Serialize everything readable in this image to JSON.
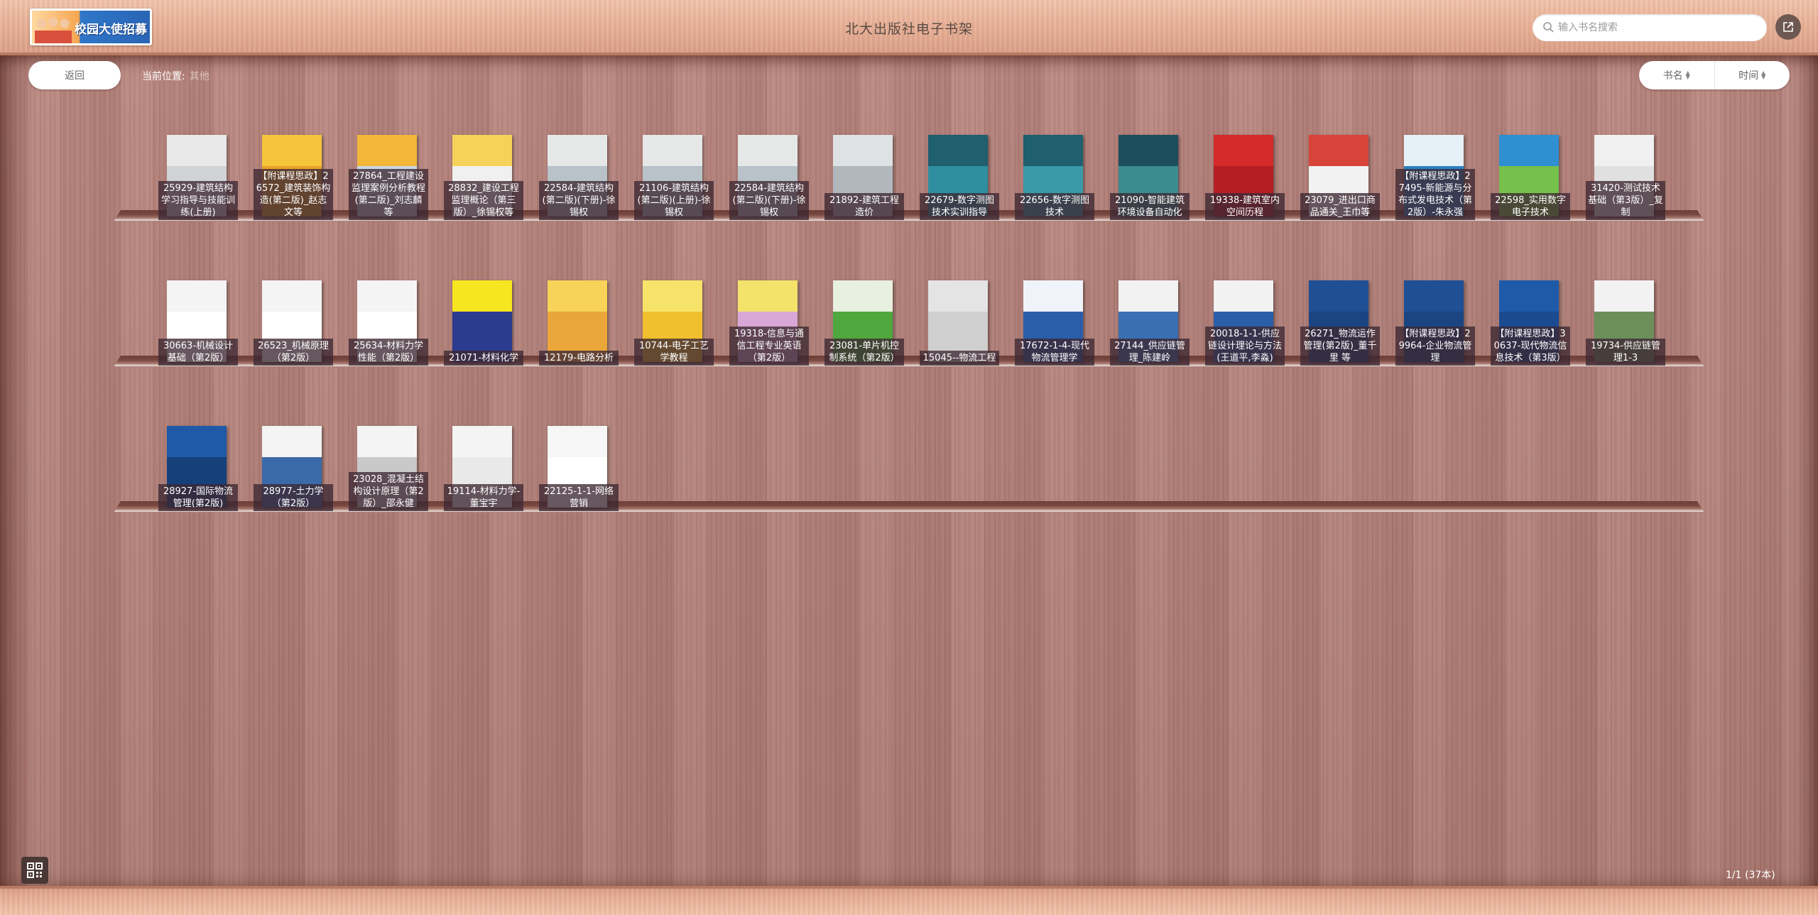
{
  "header": {
    "logo_text": "校园大使招募",
    "title": "北大出版社电子书架",
    "search_placeholder": "输入书名搜索"
  },
  "toolbar": {
    "back_label": "返回",
    "location_label": "当前位置:",
    "location_value": "其他",
    "sort_name": "书名",
    "sort_time": "时间"
  },
  "shelves": [
    [
      {
        "label": "25929-建筑结构学习指导与技能训练(上册)",
        "c1": "#e9e9e9",
        "c2": "#cfd3d6",
        "t": "#777"
      },
      {
        "label": "【附课程思政】26572_建筑装饰构造(第二版)_赵志文等",
        "c1": "#f5c53c",
        "c2": "#e9a22a",
        "t": "#7a4a10"
      },
      {
        "label": "27864_工程建设监理案例分析教程(第二版)_刘志麟等",
        "c1": "#f3b73a",
        "c2": "#c8d6e4",
        "t": "#555"
      },
      {
        "label": "28832_建设工程监理概论（第三版）_徐锡权等",
        "c1": "#f5d35a",
        "c2": "#f0f0f0",
        "t": "#555"
      },
      {
        "label": "22584-建筑结构(第二版)(下册)-徐锡权",
        "c1": "#e6e8e8",
        "c2": "#b8c2c8",
        "t": "#666"
      },
      {
        "label": "21106-建筑结构(第二版)(上册)-徐锡权",
        "c1": "#e6e8e8",
        "c2": "#b8c2c8",
        "t": "#666"
      },
      {
        "label": "22584-建筑结构(第二版)(下册)-徐锡权",
        "c1": "#e6e8e8",
        "c2": "#b8c2c8",
        "t": "#666"
      },
      {
        "label": "21892-建筑工程造价",
        "c1": "#dfe2e4",
        "c2": "#b0b8be",
        "t": "#555"
      },
      {
        "label": "22679-数字测图技术实训指导",
        "c1": "#1f5f6e",
        "c2": "#2f8fa0",
        "t": "#fff"
      },
      {
        "label": "22656-数字测图技术",
        "c1": "#1f5f6e",
        "c2": "#3a9aa8",
        "t": "#fff"
      },
      {
        "label": "21090-智能建筑环境设备自动化",
        "c1": "#1c4e5e",
        "c2": "#3c8b8f",
        "t": "#fff"
      },
      {
        "label": "19338-建筑室内空间历程",
        "c1": "#d42a2a",
        "c2": "#b31f24",
        "t": "#ffe"
      },
      {
        "label": "23079_进出口商品通关_王巾等",
        "c1": "#d9443a",
        "c2": "#f2f2f2",
        "t": "#c22"
      },
      {
        "label": "【附课程思政】27495-新能源与分布式发电技术（第2版）-朱永强",
        "c1": "#e6f1f7",
        "c2": "#2a80c0",
        "t": "#1a4f8a"
      },
      {
        "label": "22598_实用数字电子技术",
        "c1": "#2f8fd0",
        "c2": "#76c04b",
        "t": "#fff"
      },
      {
        "label": "31420-测试技术基础（第3版）_复制",
        "c1": "#f0f0f0",
        "c2": "#e0e0e0",
        "t": "#333"
      }
    ],
    [
      {
        "label": "30663-机械设计基础（第2版）",
        "c1": "#f4f4f4",
        "c2": "#ffffff",
        "t": "#222"
      },
      {
        "label": "26523_机械原理（第2版）",
        "c1": "#f4f4f4",
        "c2": "#ffffff",
        "t": "#222"
      },
      {
        "label": "25634-材料力学性能（第2版）",
        "c1": "#f4f4f4",
        "c2": "#ffffff",
        "t": "#222"
      },
      {
        "label": "21071-材料化学",
        "c1": "#f7e520",
        "c2": "#2d3b8e",
        "t": "#2d3b8e"
      },
      {
        "label": "12179-电路分析",
        "c1": "#f7d35a",
        "c2": "#eaa63a",
        "t": "#7a4a10"
      },
      {
        "label": "10744-电子工艺学教程",
        "c1": "#f6e46a",
        "c2": "#f0c02e",
        "t": "#333"
      },
      {
        "label": "19318-信息与通信工程专业英语（第2版）",
        "c1": "#f3e36a",
        "c2": "#d9a8d6",
        "t": "#7a2a7a"
      },
      {
        "label": "23081-单片机控制系统（第2版）",
        "c1": "#e8f0e0",
        "c2": "#4fa83d",
        "t": "#2a6a1a"
      },
      {
        "label": "15045--物流工程",
        "c1": "#e4e4e4",
        "c2": "#cfcfcf",
        "t": "#555"
      },
      {
        "label": "17672-1-4-现代物流管理学",
        "c1": "#f0f4fa",
        "c2": "#2a5ea8",
        "t": "#1a3f7a"
      },
      {
        "label": "27144_供应链管理_陈建岭",
        "c1": "#f2f2f2",
        "c2": "#3a6fb3",
        "t": "#1a3f7a"
      },
      {
        "label": "20018-1-1-供应链设计理论与方法(王道平,李淼)",
        "c1": "#f2f2f2",
        "c2": "#2a5ea8",
        "t": "#1a3f7a"
      },
      {
        "label": "26271_物流运作管理(第2版)_董千里 等",
        "c1": "#1f4f94",
        "c2": "#1a4482",
        "t": "#fff"
      },
      {
        "label": "【附课程思政】29964-企业物流管理",
        "c1": "#1f4f94",
        "c2": "#1a4482",
        "t": "#fff"
      },
      {
        "label": "【附课程思政】30637-现代物流信息技术（第3版）",
        "c1": "#1f5aa8",
        "c2": "#1a4a90",
        "t": "#fff"
      },
      {
        "label": "19734-供应链管理1-3",
        "c1": "#f2f2f2",
        "c2": "#6c8f5a",
        "t": "#222"
      }
    ],
    [
      {
        "label": "28927-国际物流管理(第2版)",
        "c1": "#1f5aa8",
        "c2": "#16407a",
        "t": "#fff"
      },
      {
        "label": "28977-土力学（第2版）",
        "c1": "#f4f4f4",
        "c2": "#3a6aa8",
        "t": "#1a3f7a"
      },
      {
        "label": "23028_混凝土结构设计原理（第2版）_邵永健",
        "c1": "#f4f4f4",
        "c2": "#c9c9c9",
        "t": "#222"
      },
      {
        "label": "19114-材料力学-董宝宇",
        "c1": "#f4f4f4",
        "c2": "#e9e9e9",
        "t": "#222"
      },
      {
        "label": "22125-1-1-网络营销",
        "c1": "#f6f6f6",
        "c2": "#ffffff",
        "t": "#222"
      }
    ]
  ],
  "footer": {
    "page_info": "1/1 (37本)"
  }
}
